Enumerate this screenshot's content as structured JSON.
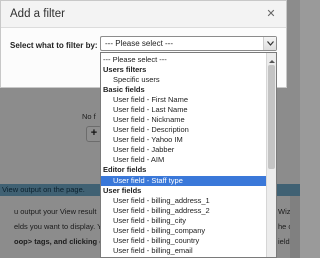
{
  "dialog": {
    "title": "Add a filter",
    "close_glyph": "✕",
    "filter_label": "Select what to filter by:",
    "select_value": "--- Please select ---"
  },
  "dropdown": {
    "options": [
      {
        "label": "--- Please select ---",
        "kind": "plain"
      },
      {
        "label": "Users filters",
        "kind": "group"
      },
      {
        "label": "Specific users",
        "kind": "item"
      },
      {
        "label": "Basic fields",
        "kind": "group"
      },
      {
        "label": "User field - First Name",
        "kind": "item"
      },
      {
        "label": "User field - Last Name",
        "kind": "item"
      },
      {
        "label": "User field - Nickname",
        "kind": "item"
      },
      {
        "label": "User field - Description",
        "kind": "item"
      },
      {
        "label": "User field - Yahoo IM",
        "kind": "item"
      },
      {
        "label": "User field - Jabber",
        "kind": "item"
      },
      {
        "label": "User field - AIM",
        "kind": "item"
      },
      {
        "label": "Editor fields",
        "kind": "group"
      },
      {
        "label": "User field - Staff type",
        "kind": "item",
        "selected": true
      },
      {
        "label": "User fields",
        "kind": "group"
      },
      {
        "label": "User field - billing_address_1",
        "kind": "item"
      },
      {
        "label": "User field - billing_address_2",
        "kind": "item"
      },
      {
        "label": "User field - billing_city",
        "kind": "item"
      },
      {
        "label": "User field - billing_company",
        "kind": "item"
      },
      {
        "label": "User field - billing_country",
        "kind": "item"
      },
      {
        "label": "User field - billing_email",
        "kind": "item"
      }
    ]
  },
  "background": {
    "no_fragment": "No f",
    "plus_glyph": "+",
    "band_text": "View output on the page.",
    "line1_left": "u output your View result",
    "line1_right": "Wizar",
    "line2_left": "elds you want to display. Y",
    "line2_right": "he cur",
    "line3_left": "oop> tags, and clicking on th",
    "line3_right": "ields"
  },
  "colors": {
    "selected_bg": "#3a78d9",
    "band_bg": "#6fa8c6"
  }
}
